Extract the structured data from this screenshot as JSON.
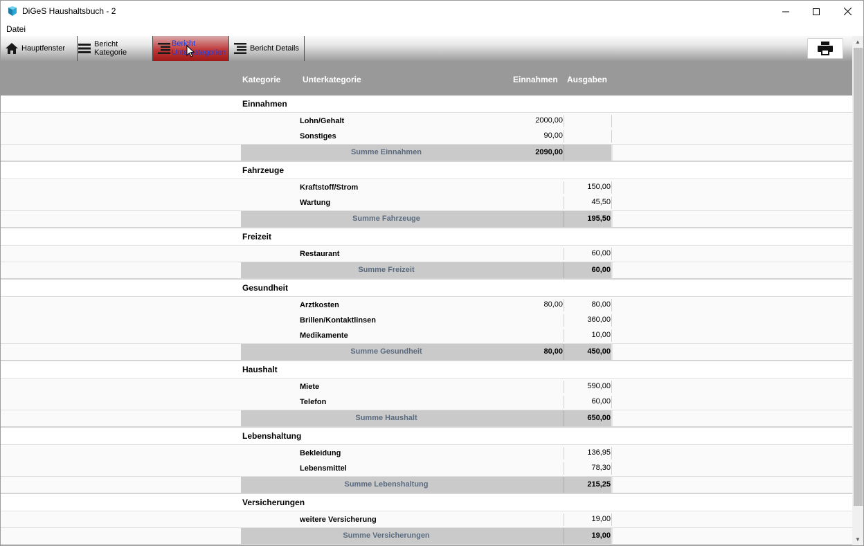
{
  "window": {
    "title": "DiGeS Haushaltsbuch - 2"
  },
  "menu": {
    "datei": "Datei"
  },
  "toolbar": {
    "hauptfenster": "Hauptfenster",
    "bericht_kategorie": "Bericht Kategorie",
    "bericht_unterkategorien_line1": "Bericht",
    "bericht_unterkategorien_line2": "Unterkategorien",
    "bericht_details": "Bericht Details"
  },
  "header": {
    "kategorie": "Kategorie",
    "unterkategorie": "Unterkategorie",
    "einnahmen": "Einnahmen",
    "ausgaben": "Ausgaben"
  },
  "groups": [
    {
      "name": "Einnahmen",
      "items": [
        {
          "label": "Lohn/Gehalt",
          "income": "2000,00",
          "expense": ""
        },
        {
          "label": "Sonstiges",
          "income": "90,00",
          "expense": ""
        }
      ],
      "sum": {
        "label": "Summe Einnahmen",
        "income": "2090,00",
        "expense": ""
      }
    },
    {
      "name": "Fahrzeuge",
      "items": [
        {
          "label": "Kraftstoff/Strom",
          "income": "",
          "expense": "150,00"
        },
        {
          "label": "Wartung",
          "income": "",
          "expense": "45,50"
        }
      ],
      "sum": {
        "label": "Summe Fahrzeuge",
        "income": "",
        "expense": "195,50"
      }
    },
    {
      "name": "Freizeit",
      "items": [
        {
          "label": "Restaurant",
          "income": "",
          "expense": "60,00"
        }
      ],
      "sum": {
        "label": "Summe Freizeit",
        "income": "",
        "expense": "60,00"
      }
    },
    {
      "name": "Gesundheit",
      "items": [
        {
          "label": "Arztkosten",
          "income": "80,00",
          "expense": "80,00"
        },
        {
          "label": "Brillen/Kontaktlinsen",
          "income": "",
          "expense": "360,00"
        },
        {
          "label": "Medikamente",
          "income": "",
          "expense": "10,00"
        }
      ],
      "sum": {
        "label": "Summe Gesundheit",
        "income": "80,00",
        "expense": "450,00"
      }
    },
    {
      "name": "Haushalt",
      "items": [
        {
          "label": "Miete",
          "income": "",
          "expense": "590,00"
        },
        {
          "label": "Telefon",
          "income": "",
          "expense": "60,00"
        }
      ],
      "sum": {
        "label": "Summe Haushalt",
        "income": "",
        "expense": "650,00"
      }
    },
    {
      "name": "Lebenshaltung",
      "items": [
        {
          "label": "Bekleidung",
          "income": "",
          "expense": "136,95"
        },
        {
          "label": "Lebensmittel",
          "income": "",
          "expense": "78,30"
        }
      ],
      "sum": {
        "label": "Summe Lebenshaltung",
        "income": "",
        "expense": "215,25"
      }
    },
    {
      "name": "Versicherungen",
      "items": [
        {
          "label": "weitere Versicherung",
          "income": "",
          "expense": "19,00"
        }
      ],
      "sum": {
        "label": "Summe Versicherungen",
        "income": "",
        "expense": "19,00"
      }
    }
  ]
}
